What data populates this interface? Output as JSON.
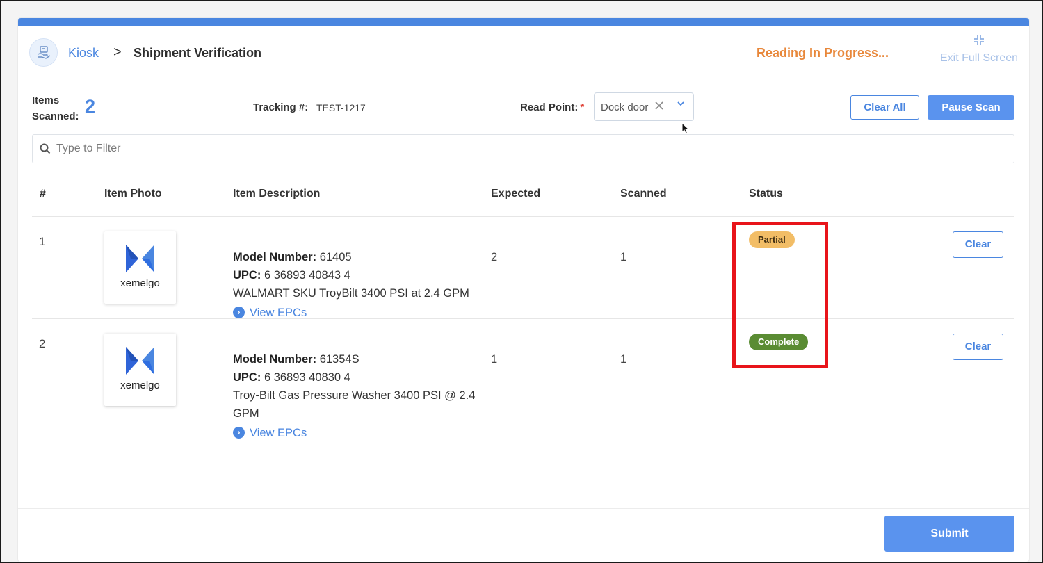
{
  "breadcrumb": {
    "root": "Kiosk",
    "separator": ">",
    "page": "Shipment Verification"
  },
  "header": {
    "status": "Reading In Progress...",
    "exit_full_screen": "Exit Full Screen"
  },
  "summary": {
    "items_scanned_label": "Items Scanned:",
    "items_scanned_count": "2"
  },
  "tracking": {
    "label": "Tracking #:",
    "value": "TEST-1217"
  },
  "read_point": {
    "label": "Read Point:",
    "required_mark": "*",
    "value": "Dock door"
  },
  "actions": {
    "clear_all": "Clear All",
    "pause_scan": "Pause Scan",
    "submit": "Submit"
  },
  "filter": {
    "placeholder": "Type to Filter"
  },
  "table": {
    "headers": [
      "#",
      "Item Photo",
      "Item Description",
      "Expected",
      "Scanned",
      "Status"
    ],
    "rows": [
      {
        "index": "1",
        "photo_brand": "xemelgo",
        "model_label": "Model Number:",
        "model": "61405",
        "upc_label": "UPC:",
        "upc": "6 36893 40843 4",
        "description": "WALMART SKU TroyBilt 3400 PSI at 2.4 GPM",
        "view_epcs": "View EPCs",
        "expected": "2",
        "scanned": "1",
        "status": "Partial",
        "clear": "Clear"
      },
      {
        "index": "2",
        "photo_brand": "xemelgo",
        "model_label": "Model Number:",
        "model": "61354S",
        "upc_label": "UPC:",
        "upc": "6 36893 40830 4",
        "description": "Troy-Bilt Gas Pressure Washer 3400 PSI @ 2.4 GPM",
        "view_epcs": "View EPCs",
        "expected": "1",
        "scanned": "1",
        "status": "Complete",
        "clear": "Clear"
      }
    ]
  },
  "colors": {
    "accent": "#4a86e0",
    "status_in_progress": "#e8873a",
    "partial": "#f2bd66",
    "complete": "#5a8c33",
    "highlight_box": "#e8141a"
  },
  "icons": {
    "kiosk": "kiosk-icon",
    "exit_full_screen": "compress-icon",
    "search": "search-icon",
    "clear_select": "close-icon",
    "dropdown": "chevron-down-icon",
    "view_epcs": "chevron-right-circle-icon"
  }
}
